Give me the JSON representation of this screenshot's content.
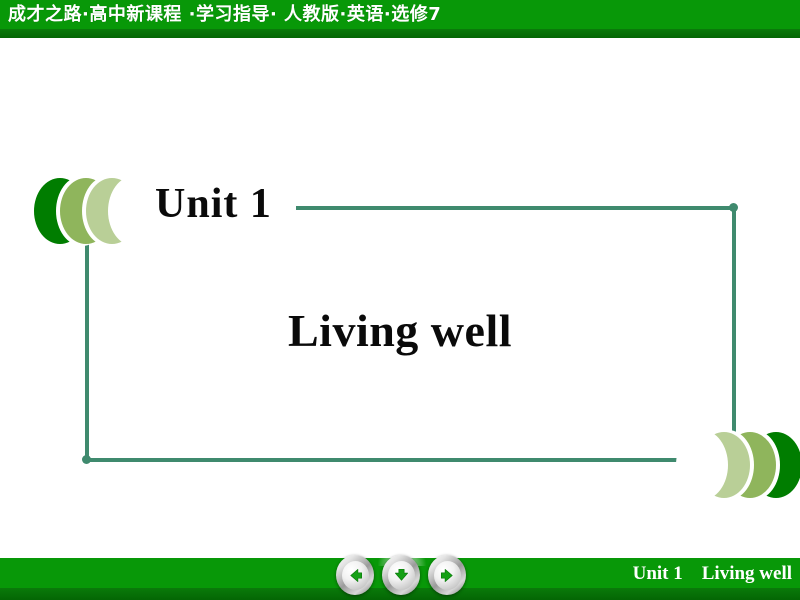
{
  "header": {
    "title": "成才之路·高中新课程 ·学习指导· 人教版·英语·选修7",
    "bg_color_top": "#089808",
    "bg_color_bottom": "#046604"
  },
  "slide": {
    "unit_label": "Unit 1",
    "lesson_title": "Living well",
    "frame_color": "#3f8a6e",
    "decor": {
      "left_chevrons_icon": "triple-crescent-left-icon",
      "right_chevrons_icon": "triple-crescent-right-icon",
      "chevron_colors": [
        "#007d00",
        "#8fb55c",
        "#b9cf97"
      ]
    }
  },
  "footer": {
    "caption": "Unit 1    Living well",
    "bg_color_top": "#089808",
    "bg_color_bottom": "#046604",
    "nav": {
      "prev": {
        "label": "Previous slide",
        "icon": "arrow-left-icon"
      },
      "down": {
        "label": "Next section",
        "icon": "arrow-down-icon"
      },
      "next": {
        "label": "Next slide",
        "icon": "arrow-right-icon"
      },
      "arrow_color": "#15a015"
    }
  }
}
